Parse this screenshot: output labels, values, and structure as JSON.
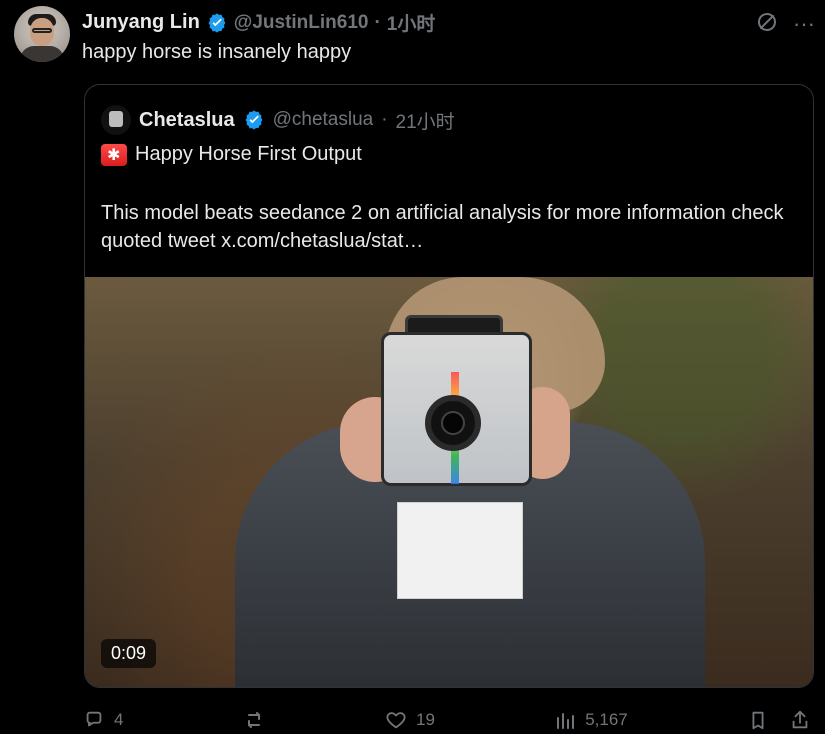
{
  "tweet": {
    "author_name": "Junyang Lin",
    "author_handle": "@JustinLin610",
    "dot": "·",
    "time": "1小时",
    "text": "happy horse is insanely happy"
  },
  "top_icons": {
    "grok_icon": "slash-circle-icon",
    "more_label": "···"
  },
  "quote": {
    "author_name": "Chetaslua",
    "author_handle": "@chetaslua",
    "dot": "·",
    "time": "21小时",
    "line1_text": "Happy Horse First Output",
    "body": "This model beats seedance 2 on artificial analysis for more information check quoted tweet  x.com/chetaslua/stat…",
    "video_duration": "0:09"
  },
  "actions": {
    "replies": "4",
    "likes": "19",
    "views": "5,167"
  },
  "colors": {
    "background": "#000000",
    "text_primary": "#e7e9ea",
    "text_secondary": "#71767b",
    "border": "#2f3336",
    "verified_blue": "#1d9bf0"
  }
}
